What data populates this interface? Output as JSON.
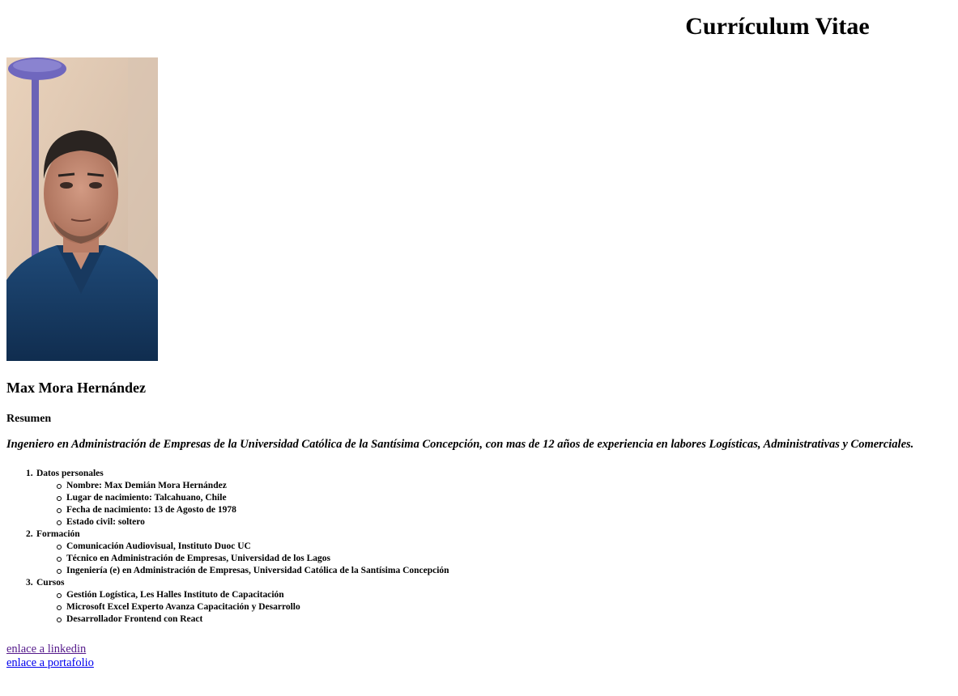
{
  "header": {
    "title": "Currículum Vitae"
  },
  "profile": {
    "photo_icon": "portrait-photo",
    "name": "Max Mora Hernández"
  },
  "summary": {
    "heading": "Resumen",
    "text": "Ingeniero en Administración de Empresas de la Universidad Católica de la Santísima Concepción, con mas de 12 años de experiencia en labores Logísticas, Administrativas y Comerciales."
  },
  "sections": [
    {
      "number": "1.",
      "label": "Datos personales",
      "items": [
        "Nombre: Max Demián Mora Hernández",
        "Lugar de nacimiento: Talcahuano, Chile",
        "Fecha de nacimiento: 13 de Agosto de 1978",
        "Estado civil: soltero"
      ]
    },
    {
      "number": "2.",
      "label": "Formación",
      "items": [
        "Comunicación Audiovisual, Instituto Duoc UC",
        "Técnico en Administración de Empresas, Universidad de los Lagos",
        "Ingeniería (e) en Administración de Empresas, Universidad Católica de la Santísima Concepción"
      ]
    },
    {
      "number": "3.",
      "label": "Cursos",
      "items": [
        "Gestión Logística, Les Halles Instituto de Capacitación",
        "Microsoft Excel Experto Avanza Capacitación y Desarrollo",
        "Desarrollador Frontend con React"
      ]
    }
  ],
  "links": {
    "linkedin": "enlace a linkedin",
    "portfolio": "enlace a portafolio"
  },
  "colors": {
    "visited_link": "#551a8b",
    "link": "#0000ee"
  }
}
